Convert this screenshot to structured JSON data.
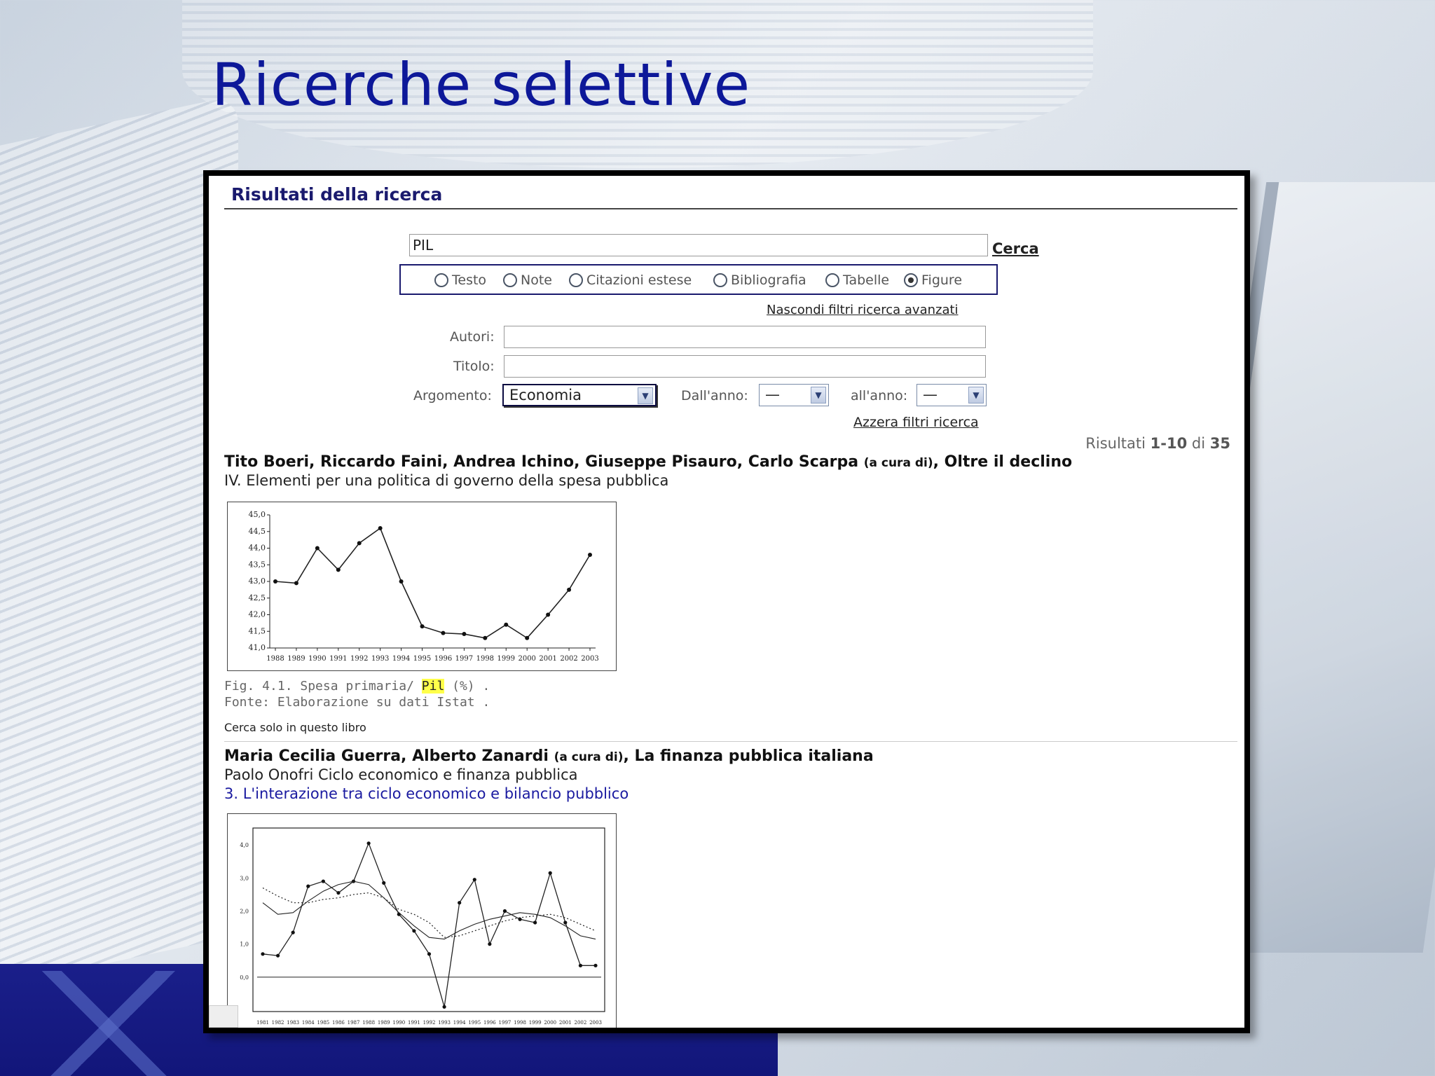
{
  "slide": {
    "title": "Ricerche selettive"
  },
  "results_header": "Risultati della ricerca",
  "search": {
    "query": "PIL",
    "button": "Cerca"
  },
  "filters": {
    "options": [
      "Testo",
      "Note",
      "Citazioni estese",
      "Bibliografia",
      "Tabelle",
      "Figure"
    ],
    "selected": "Figure",
    "hide_link": "Nascondi filtri ricerca avanzati"
  },
  "advanced": {
    "autori_label": "Autori:",
    "titolo_label": "Titolo:",
    "argomento_label": "Argomento:",
    "argomento_value": "Economia",
    "dall_anno_label": "Dall'anno:",
    "dall_anno_value": "—",
    "all_anno_label": "all'anno:",
    "all_anno_value": "—",
    "reset_link": "Azzera filtri ricerca"
  },
  "results_count": {
    "prefix": "Risultati",
    "range": "1-10",
    "of": "di",
    "total": "35"
  },
  "result1": {
    "authors": "Tito Boeri, Riccardo Faini, Andrea Ichino, Giuseppe Pisauro, Carlo Scarpa",
    "editor_note": "(a cura di)",
    "book": ", Oltre il declino",
    "chapter": "IV. Elementi per una politica di governo della spesa pubblica",
    "caption_before": "Fig. 4.1. Spesa primaria/ ",
    "caption_highlight": "Pil",
    "caption_after": " (%) .",
    "source": "Fonte: Elaborazione su dati Istat .",
    "only_book_link": "Cerca solo in questo libro"
  },
  "result2": {
    "authors": "Maria Cecilia Guerra, Alberto Zanardi",
    "editor_note": "(a cura di)",
    "book": ", La finanza pubblica italiana",
    "chapter": "Paolo Onofri Ciclo economico e finanza pubblica",
    "section_link": "3. L'interazione tra ciclo economico e bilancio pubblico"
  },
  "chart_data": [
    {
      "type": "line",
      "x": [
        "1988",
        "1989",
        "1990",
        "1991",
        "1992",
        "1993",
        "1994",
        "1995",
        "1996",
        "1997",
        "1998",
        "1999",
        "2000",
        "2001",
        "2002",
        "2003"
      ],
      "y_ticks": [
        "41,0",
        "41,5",
        "42,0",
        "42,5",
        "43,0",
        "43,5",
        "44,0",
        "44,5",
        "45,0"
      ],
      "ylim": [
        41.0,
        45.0
      ],
      "series": [
        {
          "values": [
            43.0,
            42.95,
            44.0,
            43.35,
            44.15,
            44.6,
            43.0,
            41.65,
            41.45,
            41.42,
            41.3,
            41.7,
            41.3,
            42.0,
            42.75,
            43.8
          ]
        }
      ]
    },
    {
      "type": "line",
      "x": [
        "1981",
        "1982",
        "1983",
        "1984",
        "1985",
        "1986",
        "1987",
        "1988",
        "1989",
        "1990",
        "1991",
        "1992",
        "1993",
        "1994",
        "1995",
        "1996",
        "1997",
        "1998",
        "1999",
        "2000",
        "2001",
        "2002",
        "2003"
      ],
      "y_ticks": [
        "0,0",
        "1,0",
        "2,0",
        "3,0",
        "4,0"
      ],
      "ylim": [
        -1.0,
        4.3
      ],
      "series": [
        {
          "style": "markers",
          "values": [
            0.7,
            0.65,
            1.35,
            2.75,
            2.9,
            2.55,
            2.9,
            4.05,
            2.85,
            1.9,
            1.4,
            0.7,
            -0.9,
            2.25,
            2.95,
            1.0,
            2.0,
            1.75,
            1.65,
            3.15,
            1.65,
            0.35,
            0.35
          ]
        },
        {
          "style": "solid",
          "values": [
            2.25,
            1.9,
            1.95,
            2.3,
            2.6,
            2.8,
            2.9,
            2.8,
            2.4,
            1.95,
            1.55,
            1.2,
            1.15,
            1.4,
            1.6,
            1.75,
            1.85,
            1.95,
            1.9,
            1.8,
            1.55,
            1.25,
            1.15
          ]
        },
        {
          "style": "dotted",
          "values": [
            2.7,
            2.45,
            2.25,
            2.25,
            2.35,
            2.4,
            2.5,
            2.55,
            2.4,
            2.05,
            1.9,
            1.65,
            1.2,
            1.25,
            1.4,
            1.55,
            1.7,
            1.8,
            1.85,
            1.9,
            1.8,
            1.6,
            1.4
          ]
        }
      ]
    }
  ]
}
